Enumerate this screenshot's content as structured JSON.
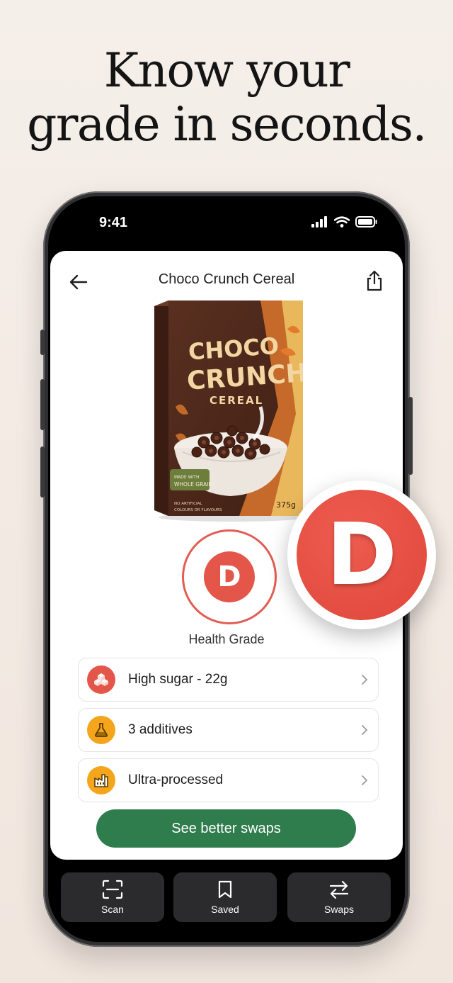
{
  "headline": {
    "line1": "Know your",
    "line2": "grade in seconds."
  },
  "status_bar": {
    "time": "9:41"
  },
  "product": {
    "title": "Choco Crunch Cereal",
    "box": {
      "brand_line1": "CHOCO",
      "brand_line2": "CRUNCH",
      "subtitle": "CEREAL",
      "badge_line1": "MADE WITH",
      "badge_line2": "WHOLE GRAINS",
      "note_line1": "NO ARTIFICIAL",
      "note_line2": "COLOURS OR FLAVOURS",
      "weight": "375g"
    }
  },
  "grade": {
    "letter": "D",
    "label": "Health Grade",
    "color": "#e35649"
  },
  "issues": [
    {
      "text": "High sugar - 22g",
      "icon": "sugar-cubes-icon",
      "color": "#e35649"
    },
    {
      "text": "3 additives",
      "icon": "flask-icon",
      "color": "#f4a51c"
    },
    {
      "text": "Ultra-processed",
      "icon": "factory-icon",
      "color": "#f4a51c"
    }
  ],
  "cta": {
    "label": "See better swaps",
    "color": "#2f7c4d"
  },
  "tabs": [
    {
      "label": "Scan",
      "icon": "scan-icon"
    },
    {
      "label": "Saved",
      "icon": "bookmark-icon"
    },
    {
      "label": "Swaps",
      "icon": "swap-arrows-icon"
    }
  ],
  "big_badge": {
    "letter": "D"
  }
}
